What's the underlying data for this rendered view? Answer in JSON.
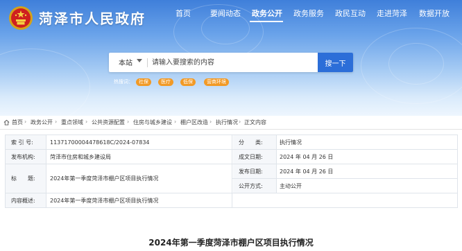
{
  "header": {
    "site_title": "菏泽市人民政府",
    "emblem_icon": "national-emblem-icon",
    "nav": [
      {
        "label": "首页",
        "active": false
      },
      {
        "label": "要闻动态",
        "active": false
      },
      {
        "label": "政务公开",
        "active": true
      },
      {
        "label": "政务服务",
        "active": false
      },
      {
        "label": "政民互动",
        "active": false
      },
      {
        "label": "走进菏泽",
        "active": false
      },
      {
        "label": "数据开放",
        "active": false
      }
    ]
  },
  "search": {
    "scope": "本站",
    "placeholder": "请输入要搜索的内容",
    "button_label": "搜一下",
    "hot_label": "热搜词：",
    "hot_tags": [
      "社保",
      "医疗",
      "低保",
      "营商环境"
    ]
  },
  "breadcrumb": {
    "home_icon": "home-icon",
    "items": [
      "首页",
      "政务公开",
      "重点领域",
      "公共资源配置",
      "住房与城乡建设",
      "棚户区改造",
      "执行情况",
      "正文内容"
    ],
    "separator": "›"
  },
  "info": {
    "index_no_label": "索 引 号:",
    "index_no": "11371700004478618C/2024-07834",
    "category_label": "分　　类:",
    "category": "执行情况",
    "publisher_label": "发布机构:",
    "publisher": "菏泽市住房和城乡建设局",
    "created_label": "成文日期:",
    "created": "2024 年 04 月 26 日",
    "title_label": "标　　题:",
    "title": "2024年第一季度菏泽市棚户区项目执行情况",
    "published_label": "发布日期:",
    "published": "2024 年 04 月 26 日",
    "method_label": "公开方式:",
    "method": "主动公开",
    "summary_label": "内容概述:",
    "summary": "2024年第一季度菏泽市棚户区项目执行情况"
  },
  "article": {
    "title": "2024年第一季度菏泽市棚户区项目执行情况"
  },
  "colors": {
    "header_top": "#3f7fda",
    "search_button": "#2c6ed8",
    "hot_tag": "#f29a26",
    "label_cell_bg": "#f5f7fa"
  }
}
